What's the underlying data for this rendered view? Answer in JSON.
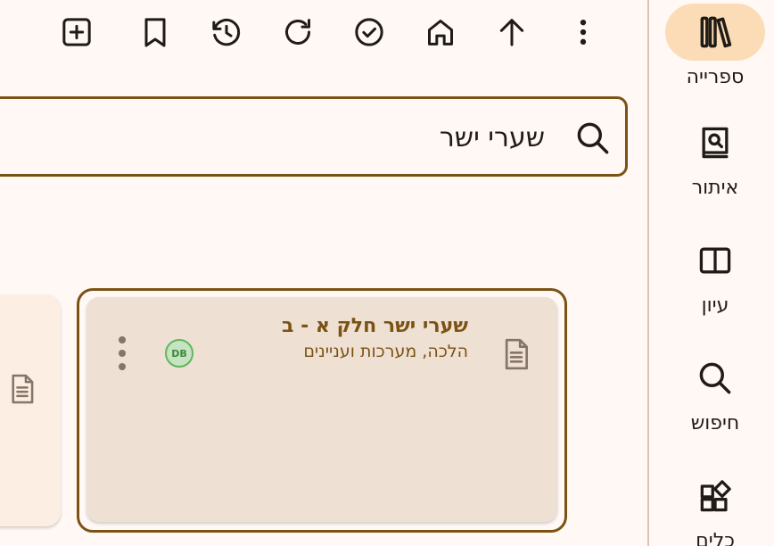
{
  "toolbar": {
    "items": [
      {
        "name": "add",
        "icon": "add-box-icon"
      },
      {
        "name": "bookmark",
        "icon": "bookmark-icon"
      },
      {
        "name": "history",
        "icon": "history-icon"
      },
      {
        "name": "refresh",
        "icon": "refresh-icon"
      },
      {
        "name": "check",
        "icon": "check-circle-icon"
      },
      {
        "name": "home",
        "icon": "home-icon"
      },
      {
        "name": "up",
        "icon": "arrow-up-icon"
      },
      {
        "name": "more",
        "icon": "more-vert-icon"
      }
    ]
  },
  "search": {
    "value": "שערי ישר",
    "icon": "search-icon"
  },
  "results": [
    {
      "title": "שערי ישר חלק א - ב",
      "subtitle": "הלכה, מערכות ועניינים",
      "badge": "DB",
      "icon": "document-icon",
      "selected": true
    }
  ],
  "rail": {
    "items": [
      {
        "label": "ספרייה",
        "icon": "library-books-icon",
        "active": true
      },
      {
        "label": "איתור",
        "icon": "find-in-book-icon",
        "active": false
      },
      {
        "label": "עיון",
        "icon": "open-book-icon",
        "active": false
      },
      {
        "label": "חיפוש",
        "icon": "search-icon",
        "active": false
      },
      {
        "label": "כלים",
        "icon": "widgets-icon",
        "active": false
      }
    ]
  },
  "colors": {
    "background": "#fff8f5",
    "accent": "#7b5213",
    "card": "#efe0d4",
    "rail_active": "#fbdcb6",
    "badge_green": "#5cb85c",
    "icon": "#1f1b16"
  }
}
